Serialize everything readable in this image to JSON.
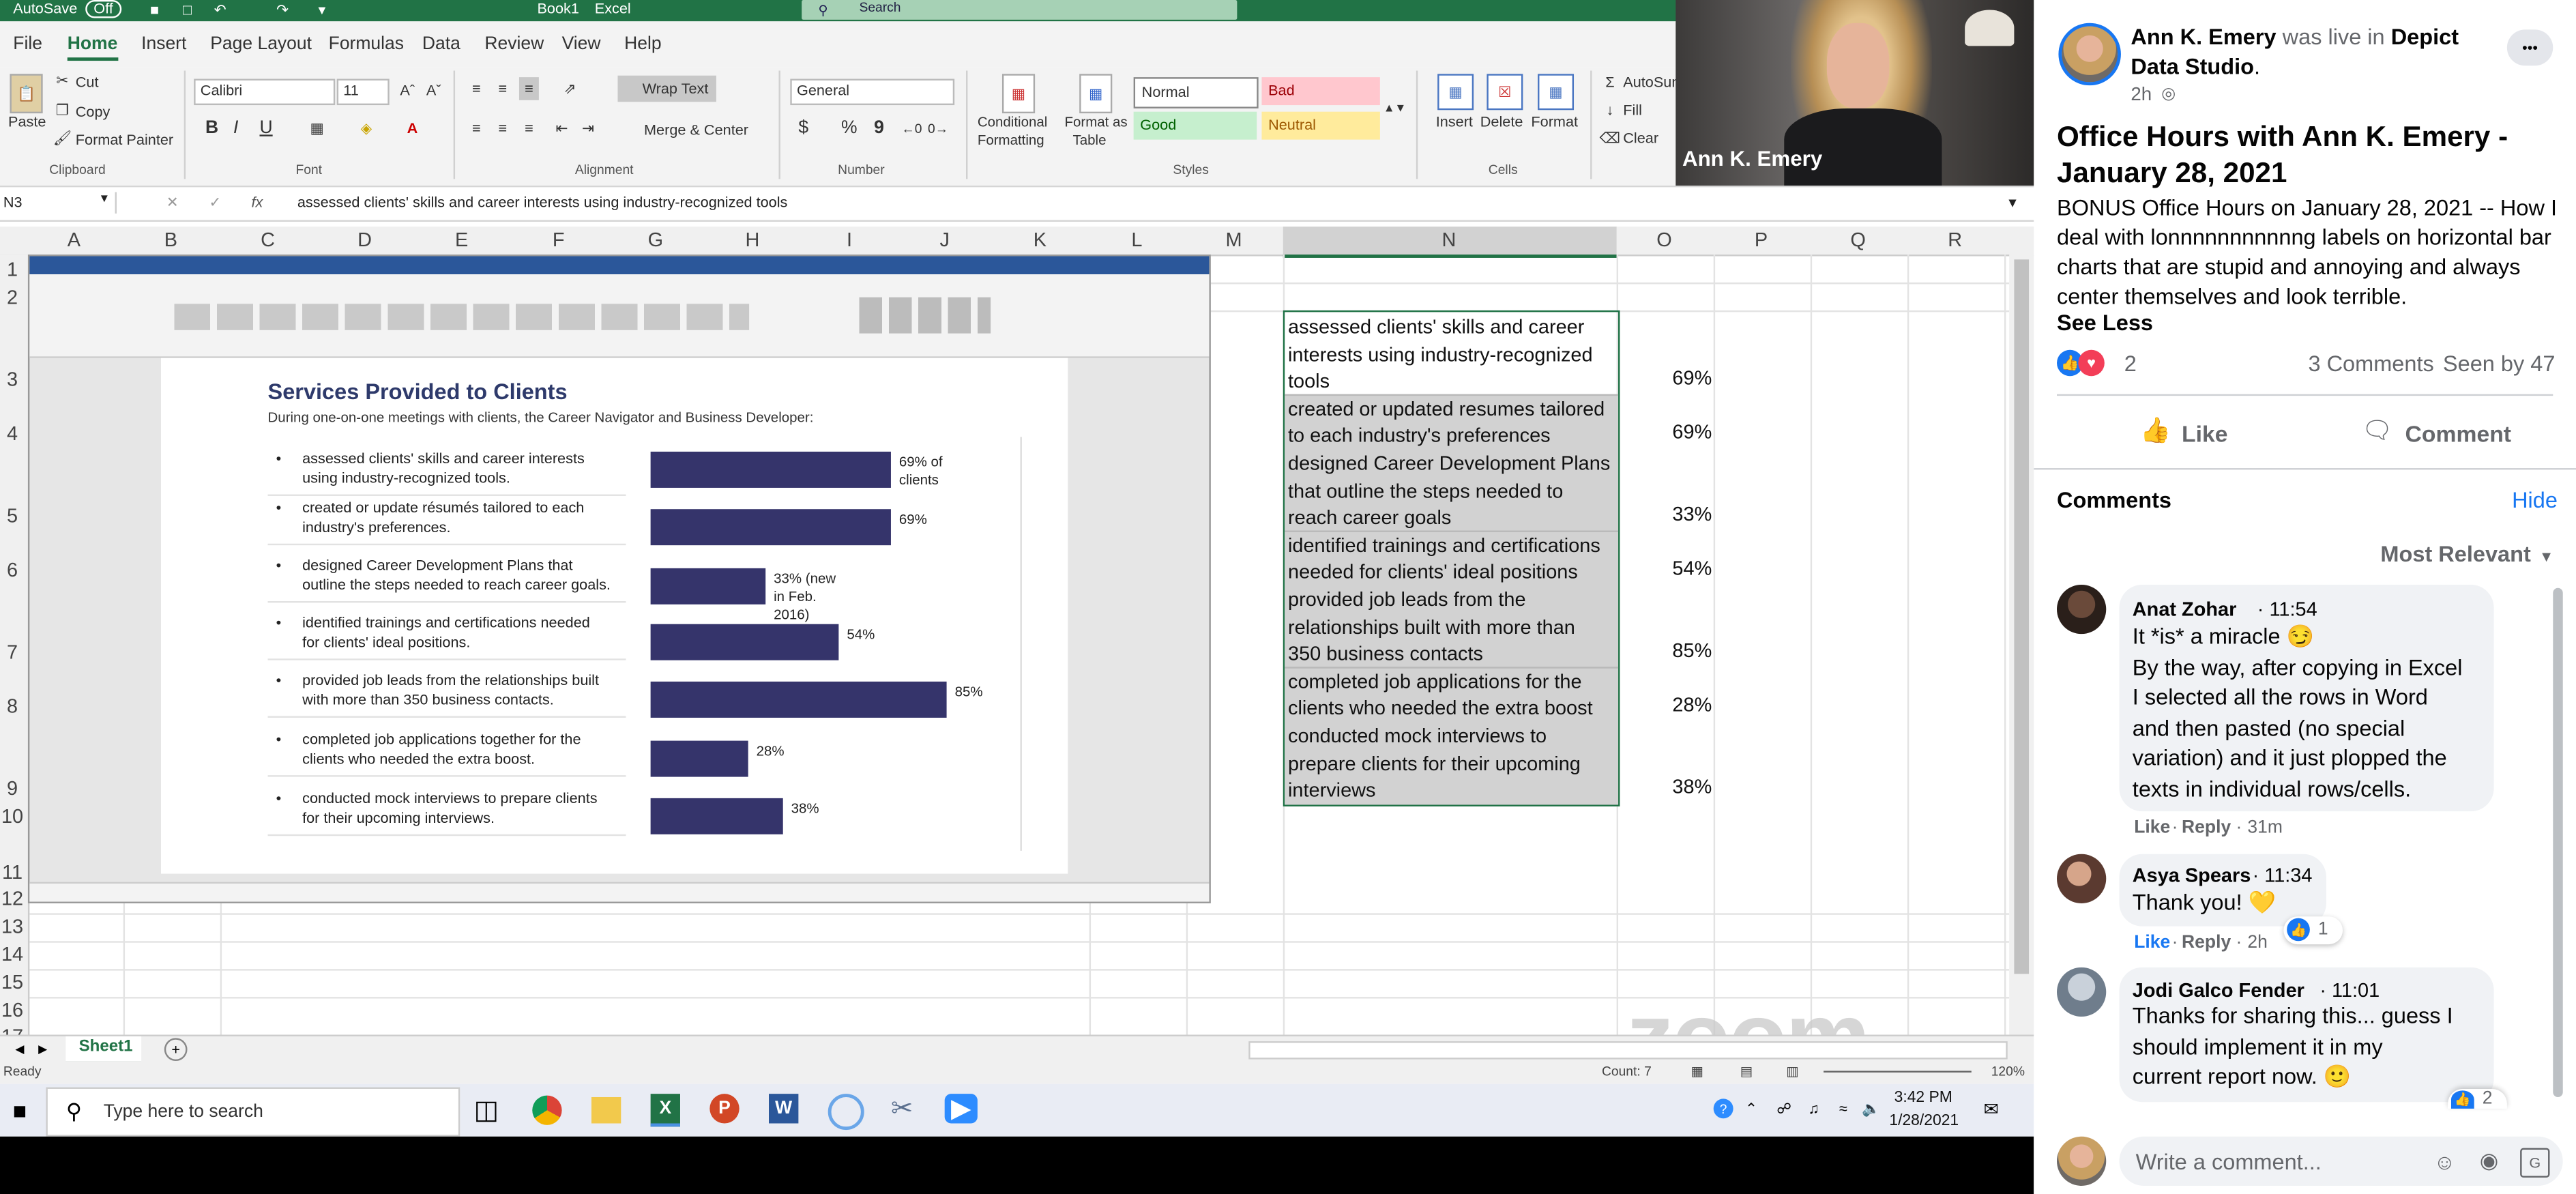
{
  "excel": {
    "titlebar": {
      "autosave": "AutoSave",
      "autosave_state": "Off",
      "book": "Book1",
      "app": "Excel",
      "search": "Search"
    },
    "menu": [
      "File",
      "Home",
      "Insert",
      "Page Layout",
      "Formulas",
      "Data",
      "Review",
      "View",
      "Help"
    ],
    "ribbon": {
      "clipboard": {
        "paste": "Paste",
        "cut": "Cut",
        "copy": "Copy",
        "painter": "Format Painter",
        "group": "Clipboard"
      },
      "font": {
        "name": "Calibri",
        "size": "11",
        "group": "Font",
        "bold": "B",
        "italic": "I",
        "underline": "U"
      },
      "alignment": {
        "wrap": "Wrap Text",
        "merge": "Merge & Center",
        "group": "Alignment"
      },
      "number": {
        "format": "General",
        "group": "Number",
        "currency": "$",
        "percent": "%",
        "comma": "9"
      },
      "styles": {
        "conditional": [
          "Conditional",
          "Formatting"
        ],
        "table": [
          "Format as",
          "Table"
        ],
        "normal": "Normal",
        "bad": "Bad",
        "good": "Good",
        "neutral": "Neutral",
        "group": "Styles"
      },
      "cells": {
        "insert": "Insert",
        "delete": "Delete",
        "format": "Format",
        "group": "Cells"
      },
      "editing": {
        "autosum": "AutoSum",
        "fill": "Fill",
        "clear": "Clear"
      }
    },
    "formula_bar": {
      "namebox": "N3",
      "fx": "fx",
      "content": "assessed clients' skills and career interests using industry-recognized tools"
    },
    "columns": [
      "A",
      "B",
      "C",
      "D",
      "E",
      "F",
      "G",
      "H",
      "I",
      "J",
      "K",
      "L",
      "M",
      "N",
      "O",
      "P",
      "Q",
      "R"
    ],
    "rows": [
      "1",
      "2",
      "3",
      "4",
      "5",
      "6",
      "7",
      "8",
      "9",
      "10",
      "11",
      "12",
      "13",
      "14",
      "15",
      "16",
      "17"
    ],
    "n_column": [
      "assessed clients' skills and career",
      "interests using industry-recognized",
      "tools",
      "created or updated resumes tailored",
      "to each industry's preferences",
      "designed Career Development Plans",
      "that outline the steps needed to",
      "reach career goals",
      "identified trainings and certifications",
      "needed for clients' ideal positions",
      "provided job leads from the",
      "relationships built with more than",
      "350 business contacts",
      "completed job applications for the",
      "clients who needed the extra boost",
      "conducted mock interviews to",
      "prepare clients for their upcoming",
      "interviews"
    ],
    "o_column": [
      "69%",
      "69%",
      "33%",
      "54%",
      "85%",
      "28%",
      "38%"
    ],
    "sheet_tab": "Sheet1",
    "status": {
      "ready": "Ready",
      "count": "Count: 7",
      "zoom": "120%"
    },
    "webcam_name": "Ann K. Emery",
    "zoom_watermark": "zoom"
  },
  "word": {
    "title": "Services Provided to Clients",
    "subtitle": "During one-on-one meetings with clients, the Career Navigator and Business Developer:",
    "items": [
      {
        "l1": "assessed clients' skills and career interests",
        "l2": "using industry-recognized tools."
      },
      {
        "l1": "created or update résumés tailored to each",
        "l2": "industry's preferences."
      },
      {
        "l1": "designed Career Development Plans that",
        "l2": "outline the steps needed to reach career goals."
      },
      {
        "l1": "identified trainings and certifications needed",
        "l2": "for clients' ideal positions."
      },
      {
        "l1": "provided job leads from the relationships built",
        "l2": "with more than 350 business contacts."
      },
      {
        "l1": "completed job applications together for the",
        "l2": "clients who needed the extra boost."
      },
      {
        "l1": "conducted mock interviews to prepare clients",
        "l2": "for their upcoming interviews."
      }
    ],
    "bar_labels": [
      [
        "69% of",
        "clients"
      ],
      [
        "69%"
      ],
      [
        "33% (new",
        "in Feb.",
        "2016)"
      ],
      [
        "54%"
      ],
      [
        "85%"
      ],
      [
        "28%"
      ],
      [
        "38%"
      ]
    ]
  },
  "chart_data": {
    "type": "bar",
    "orientation": "horizontal",
    "title": "Services Provided to Clients",
    "categories": [
      "assessed clients' skills and career interests using industry-recognized tools.",
      "created or update résumés tailored to each industry's preferences.",
      "designed Career Development Plans that outline the steps needed to reach career goals.",
      "identified trainings and certifications needed for clients' ideal positions.",
      "provided job leads from the relationships built with more than 350 business contacts.",
      "completed job applications together for the clients who needed the extra boost.",
      "conducted mock interviews to prepare clients for their upcoming interviews."
    ],
    "values": [
      69,
      69,
      33,
      54,
      85,
      28,
      38
    ],
    "xlim": [
      0,
      100
    ],
    "color": "#35346b"
  },
  "taskbar": {
    "search": "Type here to search",
    "time": "3:42 PM",
    "date": "1/28/2021"
  },
  "facebook": {
    "author": "Ann K. Emery",
    "was_live": "was live in",
    "page": "Depict Data Studio",
    "meta": "2h",
    "post_title": "Office Hours with Ann K. Emery - January 28, 2021",
    "post_body": "BONUS Office Hours on January 28, 2021 -- How I deal with lonnnnnnnnnnng labels on horizontal bar charts that are stupid and annoying and always center themselves and look terrible.",
    "see_less": "See Less",
    "reactions": "2",
    "comments_count": "3 Comments",
    "seen_by": "Seen by 47",
    "like": "Like",
    "comment": "Comment",
    "comments_header": "Comments",
    "hide": "Hide",
    "sort": "Most Relevant",
    "comments": [
      {
        "name": "Anat Zohar",
        "time": "11:54",
        "lines": [
          "It *is* a miracle 😏",
          "By the way, after copying in Excel",
          "I selected all the rows in Word",
          "and then pasted (no special",
          "variation) and it just plopped the",
          "texts in individual rows/cells."
        ],
        "reply_time": "31m"
      },
      {
        "name": "Asya Spears",
        "time": "11:34",
        "lines": [
          "Thank you! 💛"
        ],
        "reply_time": "2h",
        "reacts": "1"
      },
      {
        "name": "Jodi Galco Fender",
        "time": "11:01",
        "lines": [
          "Thanks for sharing this... guess I",
          "should implement it in my",
          "current report now. 🙂"
        ],
        "reacts": "2"
      }
    ],
    "reply": "Reply",
    "write_placeholder": "Write a comment...",
    "ellipsis": "•••"
  }
}
